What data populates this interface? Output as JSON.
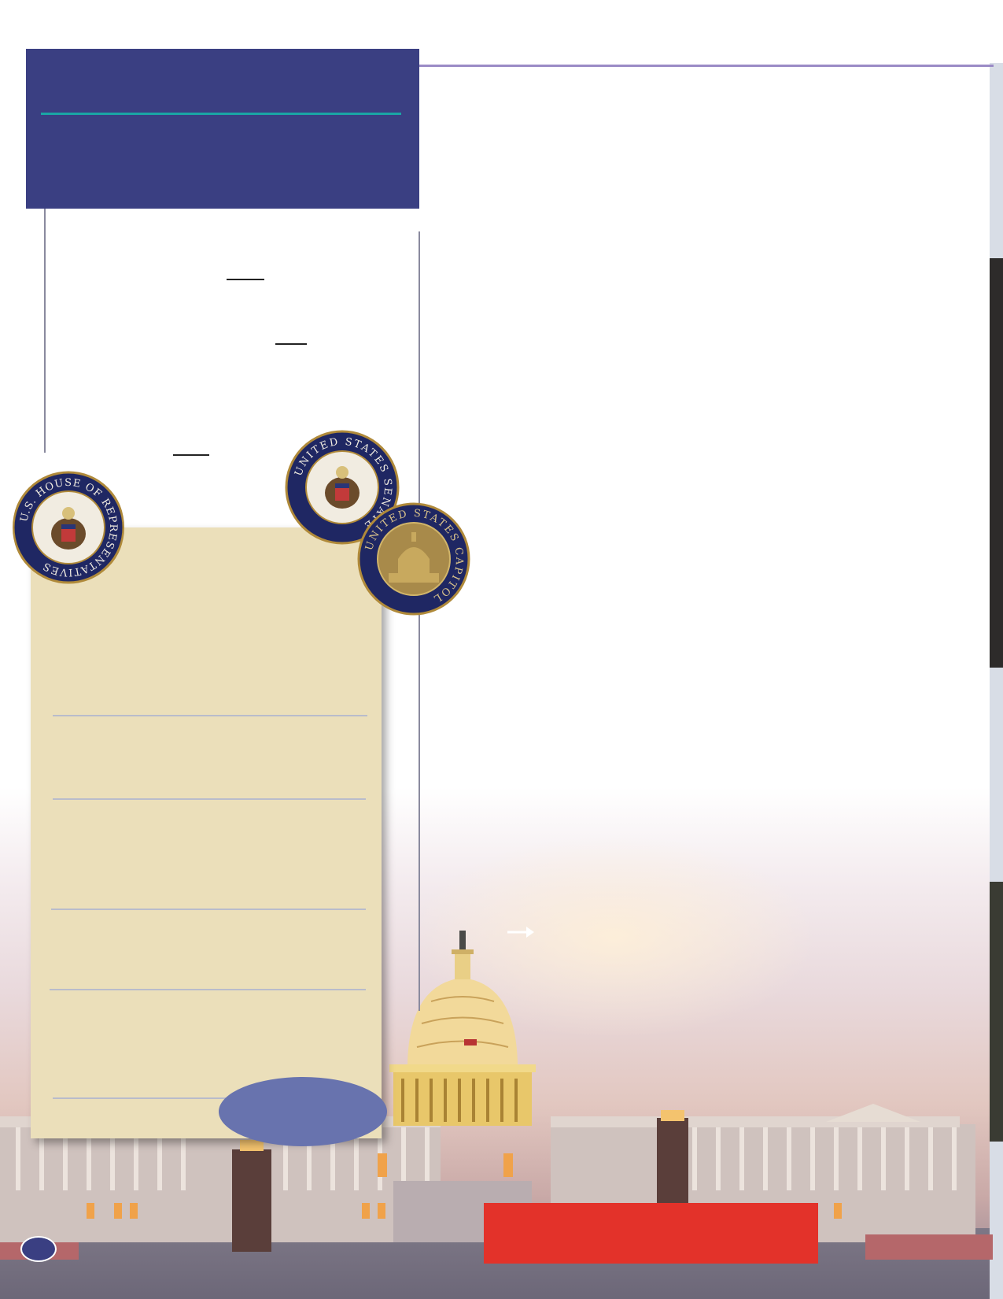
{
  "seals": {
    "house": {
      "text": "U.S. HOUSE OF REPRESENTATIVES"
    },
    "senate": {
      "text": "UNITED STATES SENATE"
    },
    "capitol": {
      "text": "UNITED STATES CAPITOL"
    }
  },
  "colors": {
    "header_blue": "#3a3f82",
    "teal_rule": "#1aa5a5",
    "panel_tan": "#ebdfba",
    "oval_blue": "#6873ae",
    "alert_red": "#e3322a",
    "seal_navy": "#1f2763",
    "seal_gold": "#b08a3a"
  },
  "icons": {
    "arrow": "right-arrow-icon",
    "page_badge": "page-number-badge"
  }
}
